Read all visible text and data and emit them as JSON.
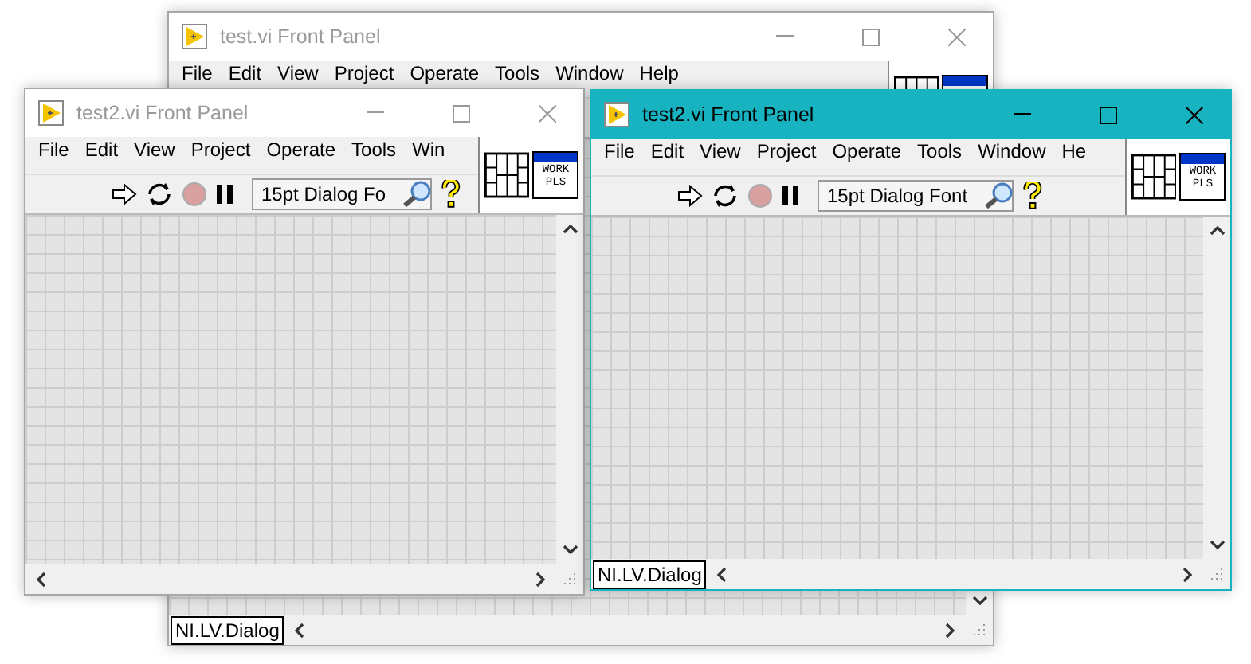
{
  "windows": [
    {
      "title": "test.vi Front Panel",
      "active": false,
      "menu": [
        "File",
        "Edit",
        "View",
        "Project",
        "Operate",
        "Tools",
        "Window",
        "Help"
      ],
      "status_label": "NI.LV.Dialog"
    },
    {
      "title": "test2.vi Front Panel",
      "active": false,
      "menu": [
        "File",
        "Edit",
        "View",
        "Project",
        "Operate",
        "Tools",
        "Win"
      ],
      "font_field": "15pt Dialog Fo",
      "icon_label": "WORK PLS"
    },
    {
      "title": "test2.vi Front Panel",
      "active": true,
      "menu": [
        "File",
        "Edit",
        "View",
        "Project",
        "Operate",
        "Tools",
        "Window",
        "He"
      ],
      "font_field": "15pt Dialog Font",
      "icon_label": "WORK PLS",
      "status_label": "NI.LV.Dialog"
    }
  ]
}
